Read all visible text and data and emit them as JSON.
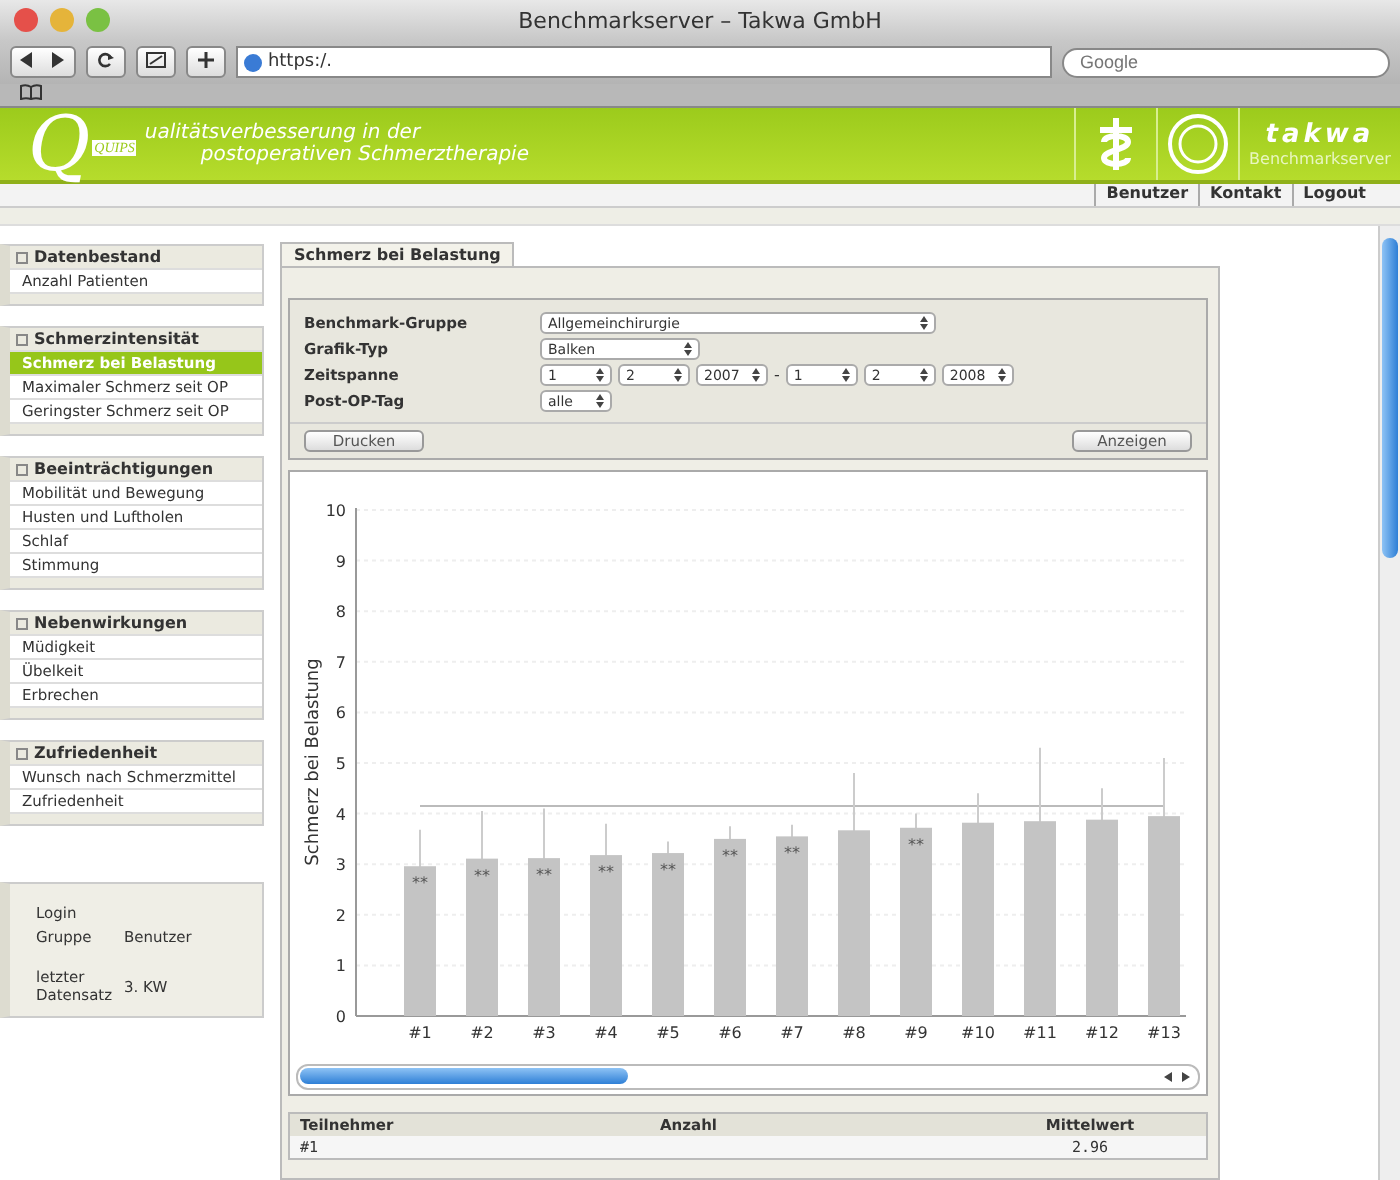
{
  "window": {
    "title": "Benchmarkserver – Takwa GmbH"
  },
  "toolbar": {
    "address": "https:/.",
    "search_placeholder": "Google"
  },
  "header": {
    "logo_initial": "Q",
    "logo_letters": "QUIPS",
    "title_line_1": "ualitätsverbesserung in der",
    "title_line_2": "postoperativen Schmerztherapie",
    "brand": "takwa",
    "brand_sub": "Benchmarkserver",
    "nav_links": [
      "Benutzer",
      "Kontakt",
      "Logout"
    ]
  },
  "sidebar": {
    "groups": [
      {
        "title": "Datenbestand",
        "items": [
          {
            "label": "Anzahl Patienten",
            "selected": false
          }
        ]
      },
      {
        "title": "Schmerzintensität",
        "items": [
          {
            "label": "Schmerz bei Belastung",
            "selected": true
          },
          {
            "label": "Maximaler Schmerz seit OP",
            "selected": false
          },
          {
            "label": "Geringster Schmerz seit OP",
            "selected": false
          }
        ]
      },
      {
        "title": "Beeinträchtigungen",
        "items": [
          {
            "label": "Mobilität und Bewegung",
            "selected": false
          },
          {
            "label": "Husten und Luftholen",
            "selected": false
          },
          {
            "label": "Schlaf",
            "selected": false
          },
          {
            "label": "Stimmung",
            "selected": false
          }
        ]
      },
      {
        "title": "Nebenwirkungen",
        "items": [
          {
            "label": "Müdigkeit",
            "selected": false
          },
          {
            "label": "Übelkeit",
            "selected": false
          },
          {
            "label": "Erbrechen",
            "selected": false
          }
        ]
      },
      {
        "title": "Zufriedenheit",
        "items": [
          {
            "label": "Wunsch nach Schmerzmittel",
            "selected": false
          },
          {
            "label": "Zufriedenheit",
            "selected": false
          }
        ]
      }
    ],
    "info": [
      {
        "label": "Login"
      },
      {
        "label": "Gruppe",
        "value": "Benutzer"
      },
      {
        "label": "letzter Datensatz",
        "value": "3. KW"
      }
    ]
  },
  "tabs": [
    {
      "label": "Schmerz bei Belastung",
      "selected": true
    }
  ],
  "form": {
    "rows": [
      {
        "label": "Benchmark-Gruppe",
        "selects": [
          {
            "value": "Allgemeinchirurgie",
            "kind": "wide"
          }
        ]
      },
      {
        "label": "Grafik-Typ",
        "selects": [
          {
            "value": "Balken",
            "kind": "medium"
          }
        ]
      },
      {
        "label": "Zeitspanne",
        "selects": [
          {
            "value": "1",
            "kind": "small"
          },
          {
            "value": "2",
            "kind": "small"
          },
          {
            "value": "2007",
            "kind": "small"
          },
          {
            "value": "-",
            "kind": "separator"
          },
          {
            "value": "1",
            "kind": "small"
          },
          {
            "value": "2",
            "kind": "small"
          },
          {
            "value": "2008",
            "kind": "small"
          }
        ]
      },
      {
        "label": "Post-OP-Tag",
        "selects": [
          {
            "value": "alle",
            "kind": "small"
          }
        ]
      }
    ],
    "buttons": [
      "Drucken",
      "Anzeigen"
    ]
  },
  "chart": {
    "chart_data": {
      "type": "bar",
      "ylabel": "Schmerz bei Belastung",
      "categories": [
        "#1",
        "#2",
        "#3",
        "#4",
        "#5",
        "#6",
        "#7",
        "#8",
        "#9",
        "#10",
        "#11",
        "#12",
        "#13"
      ],
      "series": [
        {
          "color": "#c4c4c4",
          "values": [
            2.96,
            3.11,
            3.12,
            3.18,
            3.22,
            3.5,
            3.55,
            3.67,
            3.72,
            3.82,
            3.85,
            3.88,
            3.95
          ],
          "errors": [
            0.72,
            0.94,
            0.98,
            0.62,
            0.23,
            0.25,
            0.23,
            1.13,
            0.28,
            0.58,
            1.45,
            0.62,
            1.15
          ]
        },
        {
          "type": "line",
          "color": "#bbbbbb",
          "values": [
            4.15,
            4.15,
            4.15,
            4.15,
            4.15,
            4.15,
            4.15,
            4.15,
            4.15,
            4.15,
            4.15,
            4.15,
            4.15
          ]
        }
      ],
      "ylim": [
        0,
        10
      ],
      "yticks": [
        0,
        1,
        2,
        3,
        4,
        5,
        6,
        7,
        8,
        9,
        10
      ],
      "value_labels": [
        "**",
        "**",
        "**",
        "**",
        "**",
        "**",
        "**",
        null,
        "**",
        null,
        null,
        null,
        null
      ],
      "grid": true
    }
  },
  "table": {
    "columns": [
      "Teilnehmer",
      "Anzahl",
      "Mittelwert"
    ],
    "rows": [
      [
        "#1",
        "",
        "2.96"
      ]
    ]
  }
}
